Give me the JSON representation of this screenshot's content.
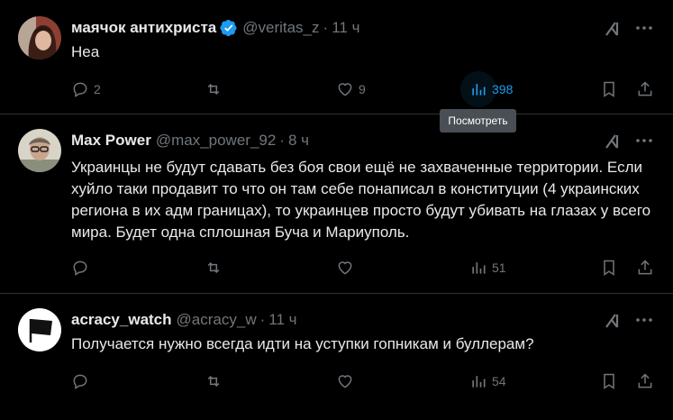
{
  "tweets": [
    {
      "name": "маячок антихриста",
      "handle": "@veritas_z",
      "separator": "·",
      "time": "11 ч",
      "verified": true,
      "text": "Неа",
      "replies": "2",
      "retweets": "",
      "likes": "9",
      "views": "398"
    },
    {
      "name": "Max Power",
      "handle": "@max_power_92",
      "separator": "·",
      "time": "8 ч",
      "verified": false,
      "text": "Украинцы не будут сдавать без боя свои ещё не захваченные территории. Если хуйло таки продавит то что он там себе понаписал в конституции (4 украинских региона в их адм границах), то украинцев просто будут убивать на глазах у всего мира. Будет одна сплошная Буча и Мариуполь.",
      "replies": "",
      "retweets": "",
      "likes": "",
      "views": "51"
    },
    {
      "name": "acracy_watch",
      "handle": "@acracy_w",
      "separator": "·",
      "time": "11 ч",
      "verified": false,
      "text": "Получается нужно всегда идти на уступки гопникам и буллерам?",
      "replies": "",
      "retweets": "",
      "likes": "",
      "views": "54"
    }
  ],
  "tooltip": "Посмотреть",
  "colors": {
    "background": "#000000",
    "text": "#e7e9ea",
    "muted": "#71767b",
    "accent": "#1d9bf0",
    "divider": "#2f3336"
  },
  "icons": [
    "reply-icon",
    "retweet-icon",
    "like-icon",
    "views-icon",
    "bookmark-icon",
    "share-icon",
    "grok-icon",
    "more-icon",
    "verified-icon"
  ]
}
